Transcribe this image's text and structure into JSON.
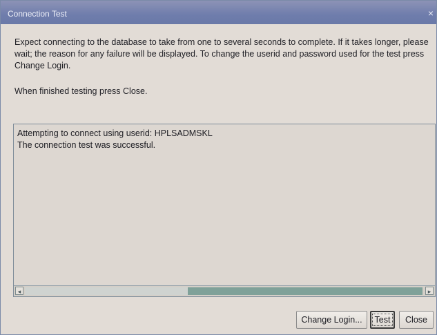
{
  "window": {
    "title": "Connection Test",
    "close_glyph": "×"
  },
  "content": {
    "instructions": "Expect connecting to the database to take from one to several seconds to complete. If it takes longer, please wait; the reason for any failure will be displayed. To change the userid and password used for the test press Change Login.",
    "finished_note": "When finished testing press Close."
  },
  "log": {
    "lines": [
      "Attempting to connect using userid:  HPLSADMSKL",
      "The connection test was successful."
    ]
  },
  "scrollbar": {
    "left_arrow": "◂",
    "right_arrow": "▸",
    "position_fraction": 0.41,
    "visible_fraction": 0.59
  },
  "buttons": {
    "change_login": "Change Login...",
    "test": "Test",
    "close": "Close"
  },
  "colors": {
    "titlebar": "#6f7dac",
    "background": "#e2dcd6",
    "scroll_thumb": "#7fa199"
  }
}
